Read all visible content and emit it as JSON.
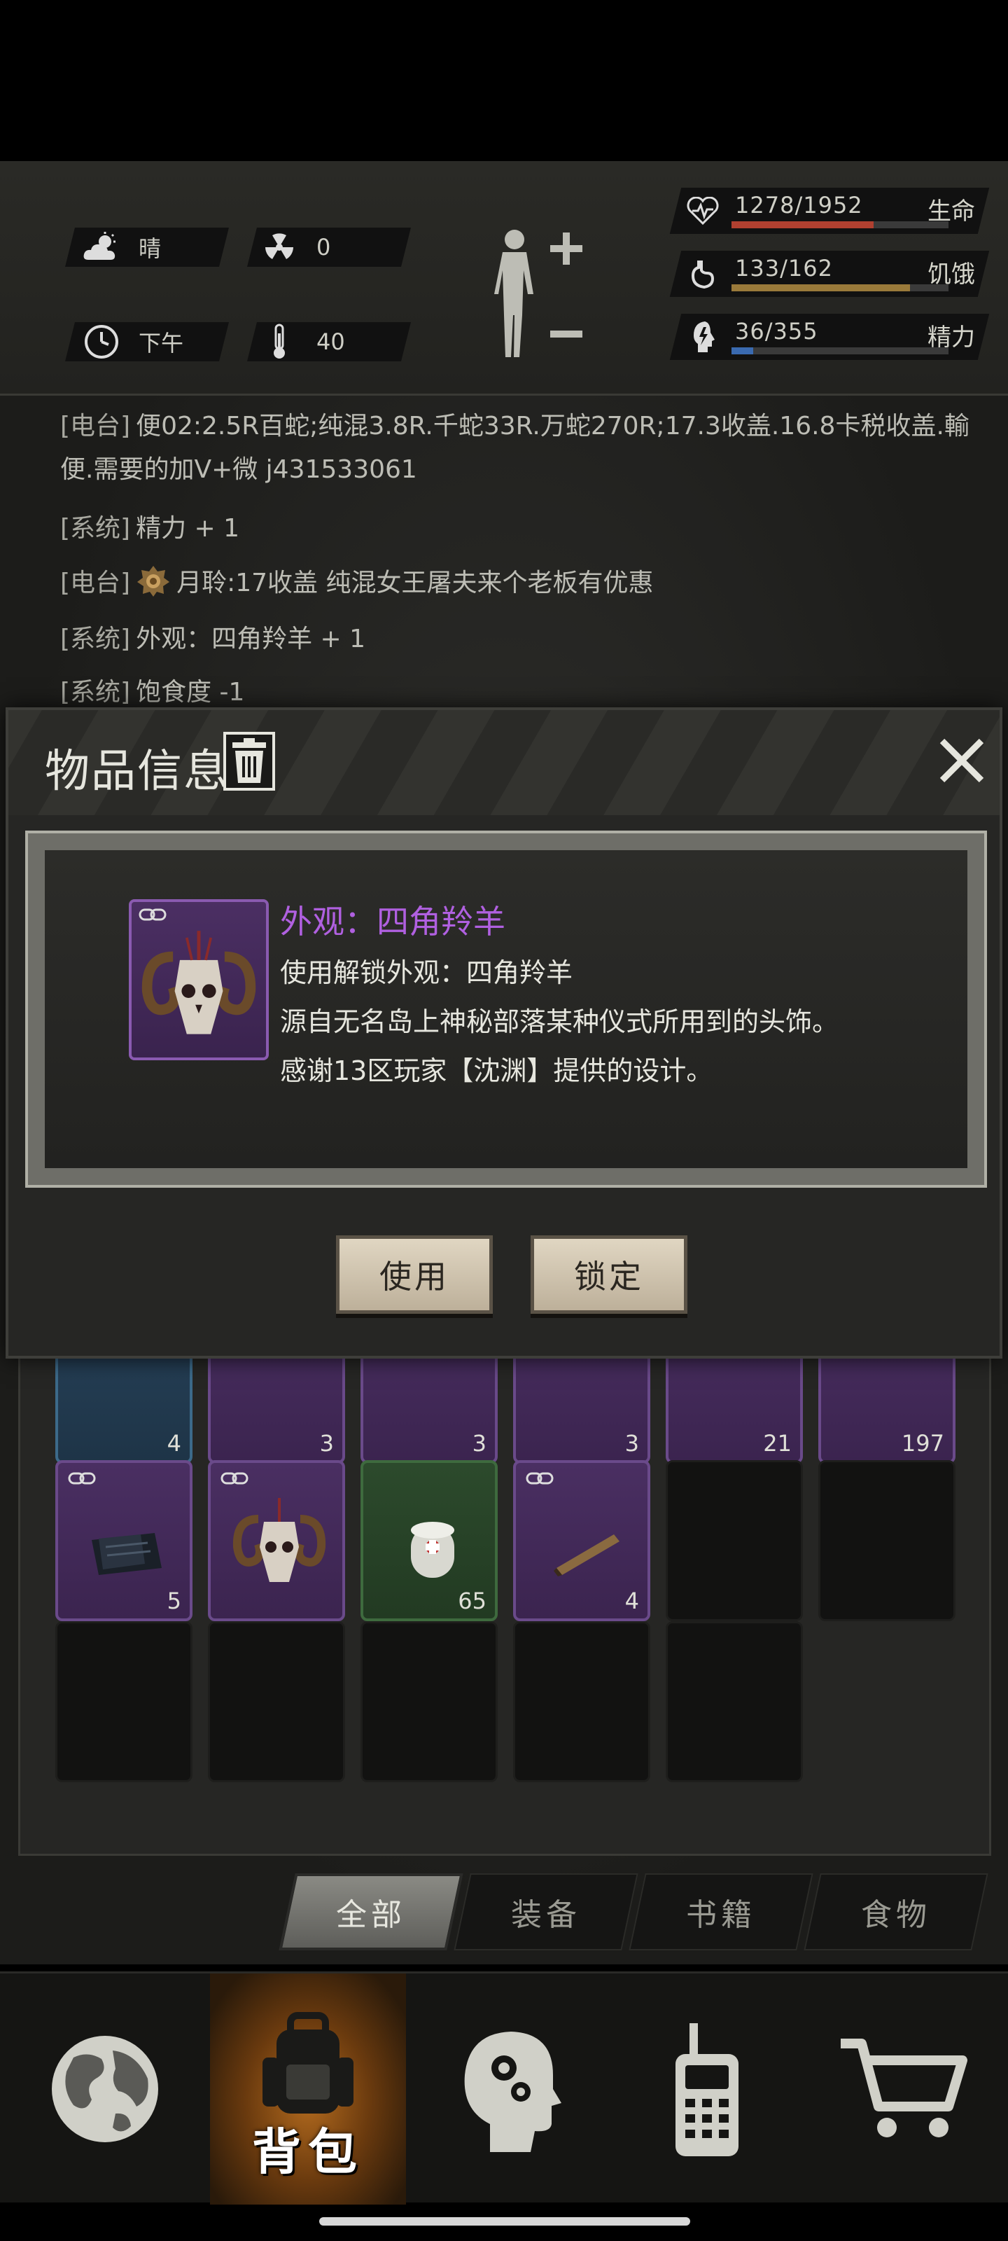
{
  "status": {
    "weather": {
      "icon": "cloud-sun-icon",
      "label": "晴"
    },
    "radiation": {
      "icon": "radiation-icon",
      "value": "0"
    },
    "time": {
      "icon": "clock-icon",
      "label": "下午"
    },
    "temperature": {
      "icon": "thermometer-icon",
      "value": "40"
    },
    "stats": [
      {
        "name": "生命",
        "value": "1278/1952",
        "fraction": 0.655,
        "color": "#b04030",
        "icon": "heart-icon"
      },
      {
        "name": "饥饿",
        "value": "133/162",
        "fraction": 0.821,
        "color": "#9a7a3a",
        "icon": "stomach-icon"
      },
      {
        "name": "精力",
        "value": "36/355",
        "fraction": 0.101,
        "color": "#3a6ab0",
        "icon": "energy-icon"
      }
    ]
  },
  "log": [
    {
      "tag": "[电台]",
      "text": "便02:2.5R百蛇;纯混3.8R.千蛇33R.万蛇270R;17.3收盖.16.8卡税收盖.輸"
    },
    {
      "tag": "",
      "text": "便.需要的加V+微 j431533061"
    },
    {
      "tag": "[系统]",
      "text": "精力 + 1"
    },
    {
      "tag": "[电台]",
      "text": "月聆:17收盖 纯混女王屠夫来个老板有优惠",
      "medal": true
    },
    {
      "tag": "[系统]",
      "text": "外观：四角羚羊 + 1"
    },
    {
      "tag": "[系统]",
      "text": "饱食度 -1"
    }
  ],
  "dialog": {
    "title": "物品信息",
    "item_name": "外观：四角羚羊",
    "desc": [
      "使用解锁外观：四角羚羊",
      "源自无名岛上神秘部落某种仪式所用到的头饰。",
      "感谢13区玩家【沈渊】提供的设计。"
    ],
    "use_label": "使用",
    "lock_label": "锁定"
  },
  "inventory": {
    "row1_counts": [
      "4",
      "3",
      "3",
      "3",
      "21",
      "197"
    ],
    "row2_counts": [
      "5",
      "",
      "65",
      "4"
    ]
  },
  "tabs": [
    {
      "label": "全部",
      "active": true
    },
    {
      "label": "装备",
      "active": false
    },
    {
      "label": "书籍",
      "active": false
    },
    {
      "label": "食物",
      "active": false
    }
  ],
  "nav": {
    "backpack_label": "背包"
  },
  "colors": {
    "accent_purple": "#b060e0",
    "active_nav": "#b26a1e"
  }
}
